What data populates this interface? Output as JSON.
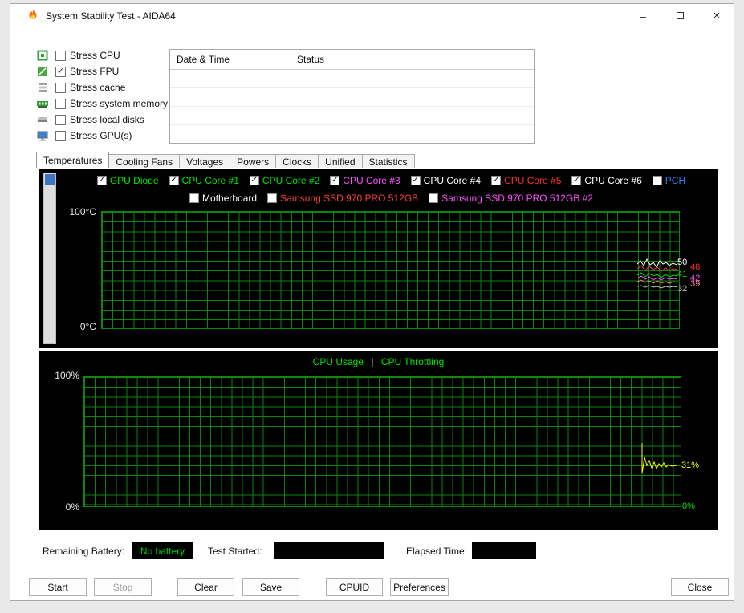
{
  "window": {
    "title": "System Stability Test - AIDA64",
    "minimize_glyph": "–",
    "close_glyph": "×"
  },
  "stress_options": [
    {
      "label": "Stress CPU",
      "checked": false
    },
    {
      "label": "Stress FPU",
      "checked": true
    },
    {
      "label": "Stress cache",
      "checked": false
    },
    {
      "label": "Stress system memory",
      "checked": false
    },
    {
      "label": "Stress local disks",
      "checked": false
    },
    {
      "label": "Stress GPU(s)",
      "checked": false
    }
  ],
  "log_table": {
    "col_datetime": "Date & Time",
    "col_status": "Status"
  },
  "tabs": [
    {
      "label": "Temperatures",
      "active": true
    },
    {
      "label": "Cooling Fans",
      "active": false
    },
    {
      "label": "Voltages",
      "active": false
    },
    {
      "label": "Powers",
      "active": false
    },
    {
      "label": "Clocks",
      "active": false
    },
    {
      "label": "Unified",
      "active": false
    },
    {
      "label": "Statistics",
      "active": false
    }
  ],
  "temperature_chart": {
    "legend_row1": [
      {
        "label": "GPU Diode",
        "checked": true,
        "color": "#00e400"
      },
      {
        "label": "CPU Core #1",
        "checked": true,
        "color": "#00e400"
      },
      {
        "label": "CPU Core #2",
        "checked": true,
        "color": "#00e400"
      },
      {
        "label": "CPU Core #3",
        "checked": true,
        "color": "#ff50ff"
      },
      {
        "label": "CPU Core #4",
        "checked": true,
        "color": "#ffffff"
      },
      {
        "label": "CPU Core #5",
        "checked": true,
        "color": "#ff3030"
      },
      {
        "label": "CPU Core #6",
        "checked": true,
        "color": "#ffffff"
      },
      {
        "label": "PCH",
        "checked": false,
        "color": "#2f7fff"
      }
    ],
    "legend_row2": [
      {
        "label": "Motherboard",
        "checked": false,
        "color": "#ffffff"
      },
      {
        "label": "Samsung SSD 970 PRO 512GB",
        "checked": false,
        "color": "#ff4040"
      },
      {
        "label": "Samsung SSD 970 PRO 512GB #2",
        "checked": false,
        "color": "#ff50ff"
      }
    ],
    "y_max": "100°C",
    "y_min": "0°C",
    "readings": [
      {
        "value": "50",
        "color": "#ffffff"
      },
      {
        "value": "48",
        "color": "#ff3030"
      },
      {
        "value": "41",
        "color": "#00e400"
      },
      {
        "value": "42",
        "color": "#ff50ff"
      },
      {
        "value": "39",
        "color": "#ff8888"
      },
      {
        "value": "32",
        "color": "#bbbbbb"
      }
    ]
  },
  "usage_chart": {
    "title_left": "CPU Usage",
    "separator": "|",
    "title_right": "CPU Throttling",
    "title_color": "#00e400",
    "separator_color": "#d8d8d8",
    "y_max": "100%",
    "y_min": "0%",
    "usage_value": "31%",
    "usage_color": "#ffff00",
    "throttle_value": "0%",
    "throttle_color": "#00e400"
  },
  "status_bar": {
    "battery_label": "Remaining Battery:",
    "battery_value": "No battery",
    "battery_value_color": "#00d000",
    "test_started_label": "Test Started:",
    "test_started_value": "",
    "elapsed_label": "Elapsed Time:",
    "elapsed_value": ""
  },
  "buttons": {
    "start": "Start",
    "stop": "Stop",
    "clear": "Clear",
    "save": "Save",
    "cpuid": "CPUID",
    "preferences": "Preferences",
    "close": "Close"
  }
}
